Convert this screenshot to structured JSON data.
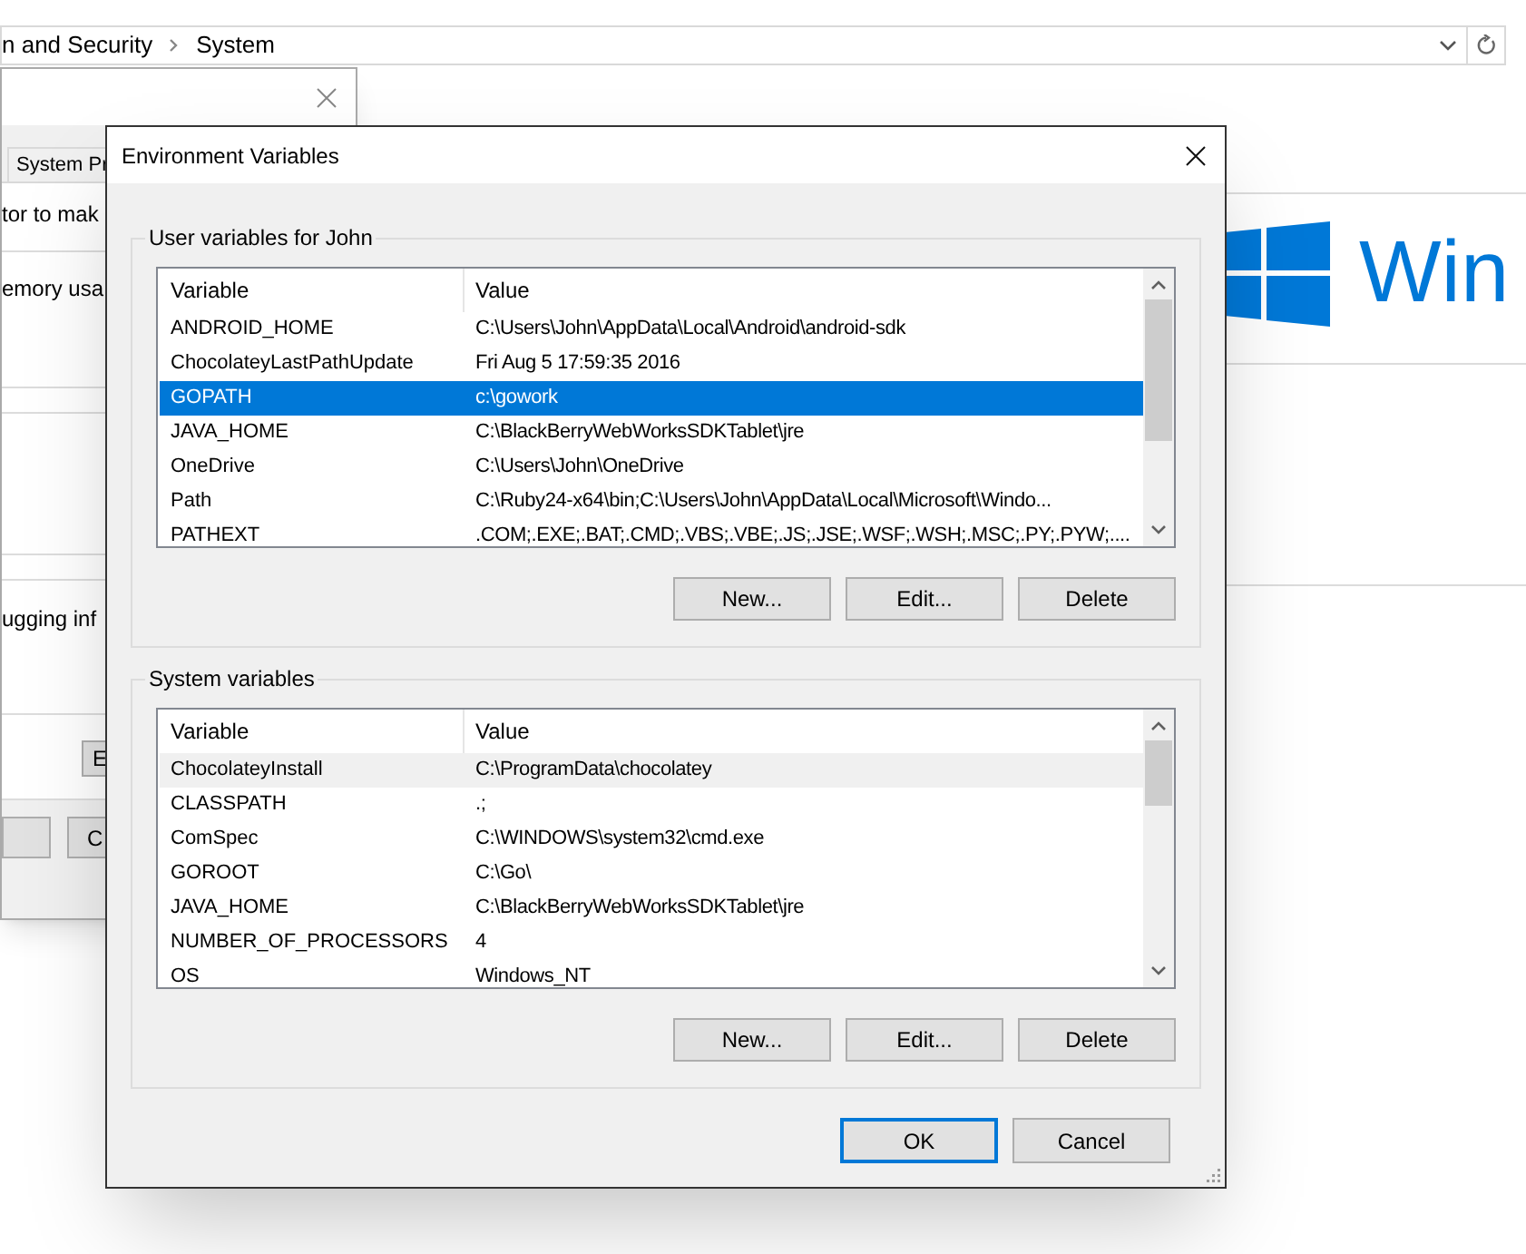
{
  "address_bar": {
    "breadcrumbs": [
      "n and Security",
      "System"
    ]
  },
  "brand": {
    "text": "Win"
  },
  "system_properties": {
    "tab": "System Pr",
    "texts": [
      "tor to mak",
      "emory usa",
      "ugging inf"
    ],
    "side_button": "E",
    "bottom_button": "C"
  },
  "dialog": {
    "title": "Environment Variables",
    "groups": [
      {
        "title": "User variables for John",
        "columns": [
          "Variable",
          "Value"
        ],
        "rows": [
          {
            "name": "ANDROID_HOME",
            "value": "C:\\Users\\John\\AppData\\Local\\Android\\android-sdk",
            "selected": false,
            "highlighted": false
          },
          {
            "name": "ChocolateyLastPathUpdate",
            "value": "Fri Aug  5 17:59:35 2016",
            "selected": false,
            "highlighted": false
          },
          {
            "name": "GOPATH",
            "value": "c:\\gowork",
            "selected": true,
            "highlighted": false
          },
          {
            "name": "JAVA_HOME",
            "value": "C:\\BlackBerryWebWorksSDKTablet\\jre",
            "selected": false,
            "highlighted": false
          },
          {
            "name": "OneDrive",
            "value": "C:\\Users\\John\\OneDrive",
            "selected": false,
            "highlighted": false
          },
          {
            "name": "Path",
            "value": "C:\\Ruby24-x64\\bin;C:\\Users\\John\\AppData\\Local\\Microsoft\\Windo...",
            "selected": false,
            "highlighted": false
          },
          {
            "name": "PATHEXT",
            "value": ".COM;.EXE;.BAT;.CMD;.VBS;.VBE;.JS;.JSE;.WSF;.WSH;.MSC;.PY;.PYW;....",
            "selected": false,
            "highlighted": false
          }
        ],
        "buttons": [
          "New...",
          "Edit...",
          "Delete"
        ]
      },
      {
        "title": "System variables",
        "columns": [
          "Variable",
          "Value"
        ],
        "rows": [
          {
            "name": "ChocolateyInstall",
            "value": "C:\\ProgramData\\chocolatey",
            "selected": false,
            "highlighted": true
          },
          {
            "name": "CLASSPATH",
            "value": ".;",
            "selected": false,
            "highlighted": false
          },
          {
            "name": "ComSpec",
            "value": "C:\\WINDOWS\\system32\\cmd.exe",
            "selected": false,
            "highlighted": false
          },
          {
            "name": "GOROOT",
            "value": "C:\\Go\\",
            "selected": false,
            "highlighted": false
          },
          {
            "name": "JAVA_HOME",
            "value": "C:\\BlackBerryWebWorksSDKTablet\\jre",
            "selected": false,
            "highlighted": false
          },
          {
            "name": "NUMBER_OF_PROCESSORS",
            "value": "4",
            "selected": false,
            "highlighted": false
          },
          {
            "name": "OS",
            "value": "Windows_NT",
            "selected": false,
            "highlighted": false
          }
        ],
        "buttons": [
          "New...",
          "Edit...",
          "Delete"
        ]
      }
    ],
    "buttons": [
      {
        "label": "OK",
        "default": true
      },
      {
        "label": "Cancel",
        "default": false
      }
    ]
  }
}
